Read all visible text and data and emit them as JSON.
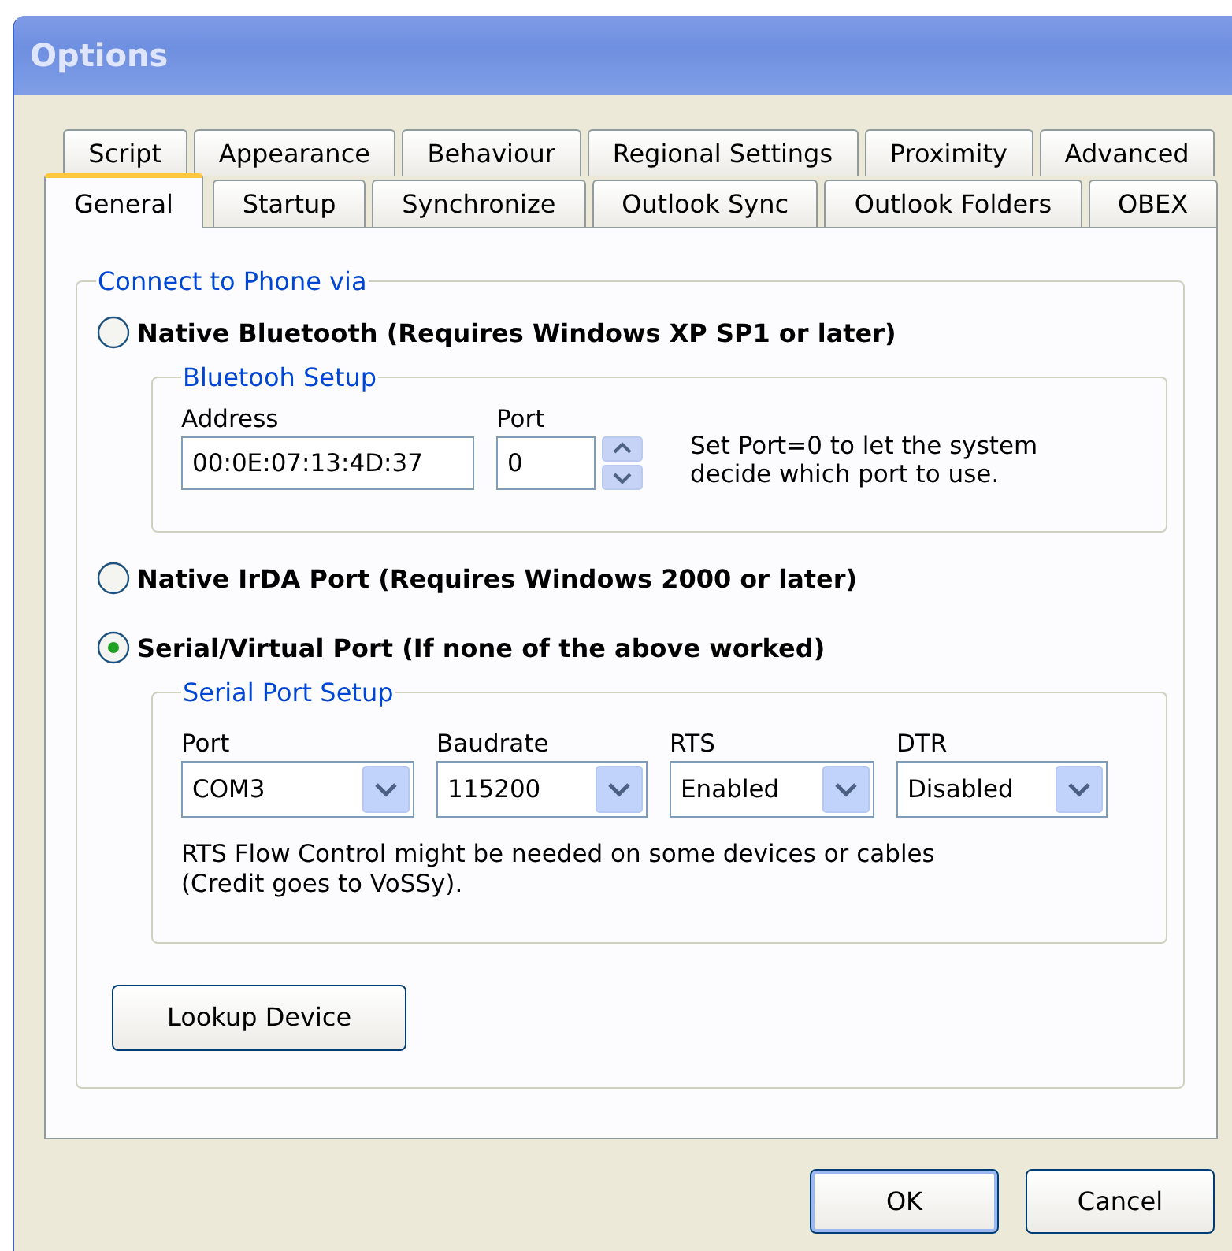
{
  "window": {
    "title": "Options"
  },
  "tab_rows": [
    [
      {
        "label": "Script",
        "selected": false
      },
      {
        "label": "Appearance",
        "selected": false
      },
      {
        "label": "Behaviour",
        "selected": false
      },
      {
        "label": "Regional Settings",
        "selected": false
      },
      {
        "label": "Proximity",
        "selected": false
      },
      {
        "label": "Advanced",
        "selected": false
      }
    ],
    [
      {
        "label": "General",
        "selected": true
      },
      {
        "label": "Startup",
        "selected": false
      },
      {
        "label": "Synchronize",
        "selected": false
      },
      {
        "label": "Outlook Sync",
        "selected": false
      },
      {
        "label": "Outlook Folders",
        "selected": false
      },
      {
        "label": "OBEX",
        "selected": false
      }
    ]
  ],
  "connection": {
    "legend": "Connect to Phone via",
    "options": [
      {
        "label": "Native Bluetooth (Requires Windows XP SP1 or later)",
        "selected": false,
        "setup": {
          "kind": "bluetooth",
          "legend": "Bluetooh Setup",
          "address": {
            "label": "Address",
            "value": "00:0E:07:13:4D:37"
          },
          "port": {
            "label": "Port",
            "value": "0"
          },
          "hint": "Set Port=0 to let the system decide which port to use."
        }
      },
      {
        "label": "Native IrDA Port (Requires Windows 2000 or later)",
        "selected": false
      },
      {
        "label": "Serial/Virtual Port (If none of the above worked)",
        "selected": true,
        "setup": {
          "kind": "serial",
          "legend": "Serial Port Setup",
          "dropdowns": [
            {
              "label": "Port",
              "value": "COM3"
            },
            {
              "label": "Baudrate",
              "value": "115200"
            },
            {
              "label": "RTS",
              "value": "Enabled"
            },
            {
              "label": "DTR",
              "value": "Disabled"
            }
          ],
          "note": "RTS Flow Control might be needed on some devices or cables (Credit goes to VoSSy)."
        }
      }
    ],
    "lookup_button": "Lookup Device"
  },
  "buttons": [
    {
      "label": "OK",
      "default": true
    },
    {
      "label": "Cancel",
      "default": false
    }
  ]
}
